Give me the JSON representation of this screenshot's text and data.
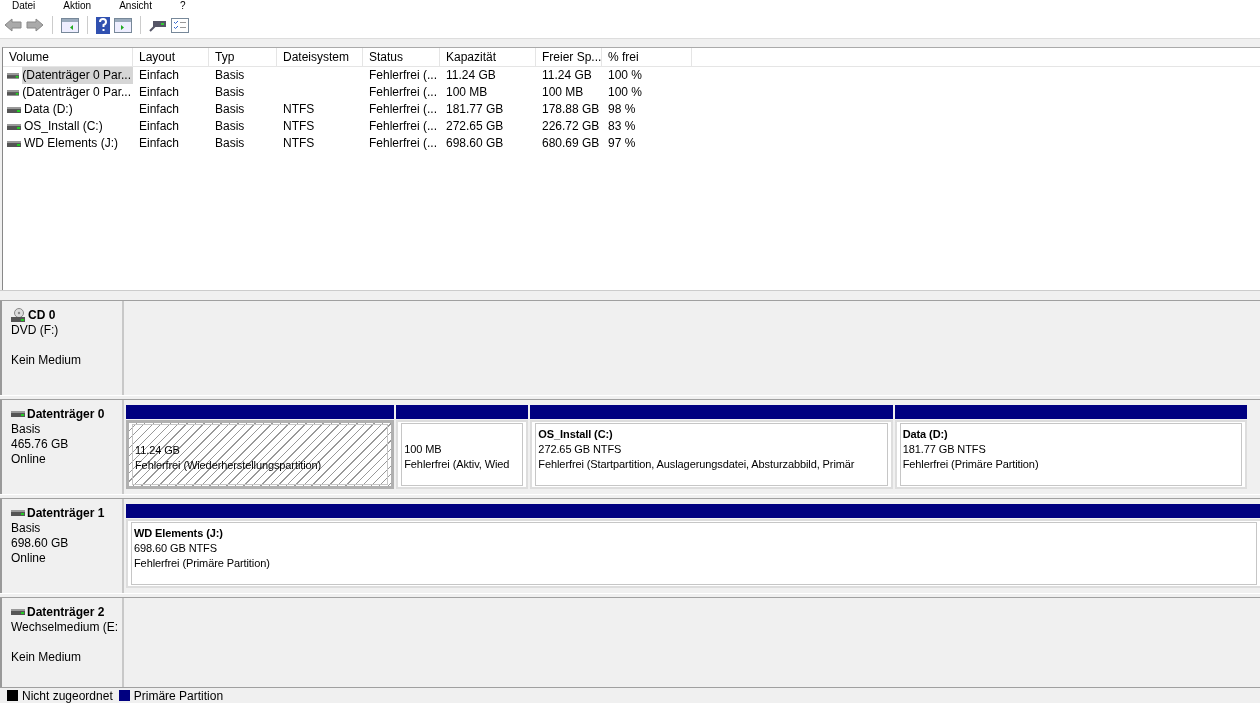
{
  "menu": [
    "Datei",
    "Aktion",
    "Ansicht",
    "?"
  ],
  "volume_list": {
    "columns": [
      "Volume",
      "Layout",
      "Typ",
      "Dateisystem",
      "Status",
      "Kapazität",
      "Freier Sp...",
      "% frei"
    ],
    "rows": [
      {
        "selected": true,
        "cells": [
          "(Datenträger 0 Par...",
          "Einfach",
          "Basis",
          "",
          "Fehlerfrei (...",
          "11.24 GB",
          "11.24 GB",
          "100 %"
        ]
      },
      {
        "selected": false,
        "cells": [
          "(Datenträger 0 Par...",
          "Einfach",
          "Basis",
          "",
          "Fehlerfrei (...",
          "100 MB",
          "100 MB",
          "100 %"
        ]
      },
      {
        "selected": false,
        "cells": [
          "Data (D:)",
          "Einfach",
          "Basis",
          "NTFS",
          "Fehlerfrei (...",
          "181.77 GB",
          "178.88 GB",
          "98 %"
        ]
      },
      {
        "selected": false,
        "cells": [
          "OS_Install (C:)",
          "Einfach",
          "Basis",
          "NTFS",
          "Fehlerfrei (...",
          "272.65 GB",
          "226.72 GB",
          "83 %"
        ]
      },
      {
        "selected": false,
        "cells": [
          "WD Elements (J:)",
          "Einfach",
          "Basis",
          "NTFS",
          "Fehlerfrei (...",
          "698.60 GB",
          "680.69 GB",
          "97 %"
        ]
      }
    ]
  },
  "disks": [
    {
      "kind": "cd",
      "name": "CD 0",
      "type": "DVD (F:)",
      "status": "Kein Medium"
    },
    {
      "kind": "disk",
      "name": "Datenträger 0",
      "type": "Basis",
      "size": "465.76 GB",
      "status": "Online",
      "partitions": [
        {
          "selected": true,
          "size": "11.24 GB",
          "status": "Fehlerfrei (Wiederherstellungspartition)"
        },
        {
          "selected": false,
          "size": "100 MB",
          "status": "Fehlerfrei (Aktiv, Wied"
        },
        {
          "selected": false,
          "title": "OS_Install  (C:)",
          "size": "272.65 GB NTFS",
          "status": "Fehlerfrei (Startpartition, Auslagerungsdatei, Absturzabbild, Primär"
        },
        {
          "selected": false,
          "title": "Data  (D:)",
          "size": "181.77 GB NTFS",
          "status": "Fehlerfrei (Primäre Partition)"
        }
      ]
    },
    {
      "kind": "disk",
      "name": "Datenträger 1",
      "type": "Basis",
      "size": "698.60 GB",
      "status": "Online",
      "partitions": [
        {
          "selected": false,
          "title": "WD Elements  (J:)",
          "size": "698.60 GB NTFS",
          "status": "Fehlerfrei (Primäre Partition)"
        }
      ]
    },
    {
      "kind": "disk",
      "name": "Datenträger 2",
      "type": "Wechselmedium (E:",
      "status": "Kein Medium"
    }
  ],
  "legend": [
    {
      "label": "Nicht zugeordnet",
      "color": "#000000"
    },
    {
      "label": "Primäre Partition",
      "color": "#000080"
    }
  ]
}
